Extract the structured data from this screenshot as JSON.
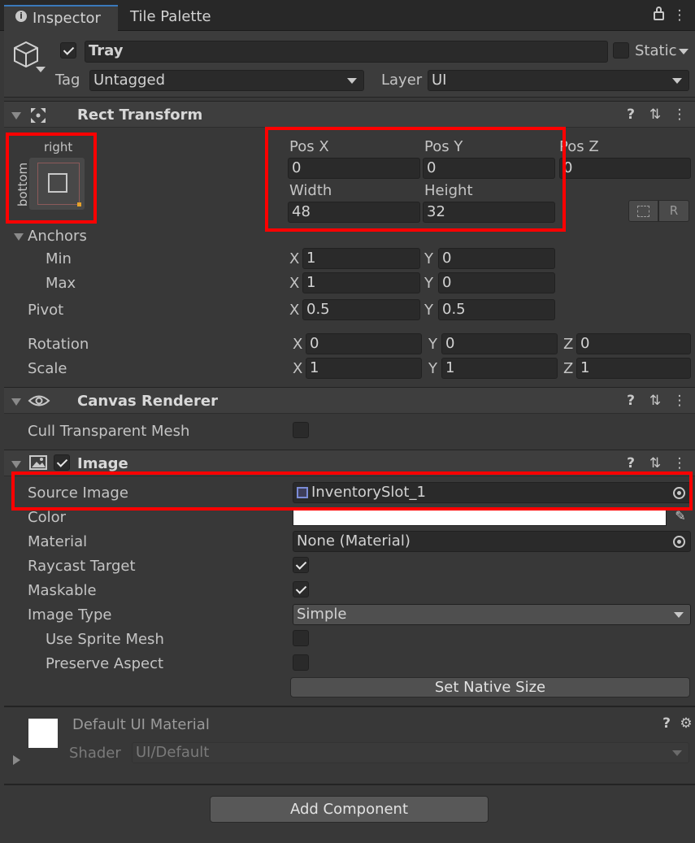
{
  "tabs": {
    "inspector": "Inspector",
    "tile_palette": "Tile Palette"
  },
  "object": {
    "name": "Tray",
    "static_label": "Static",
    "tag_label": "Tag",
    "tag_value": "Untagged",
    "layer_label": "Layer",
    "layer_value": "UI"
  },
  "rect_transform": {
    "title": "Rect Transform",
    "anchor_top_label": "right",
    "anchor_side_label": "bottom",
    "pos_x_label": "Pos X",
    "pos_x": "0",
    "pos_y_label": "Pos Y",
    "pos_y": "0",
    "pos_z_label": "Pos Z",
    "pos_z": "0",
    "width_label": "Width",
    "width": "48",
    "height_label": "Height",
    "height": "32",
    "blueprint_btn": "R",
    "anchors_label": "Anchors",
    "min_label": "Min",
    "min_x": "1",
    "min_y": "0",
    "max_label": "Max",
    "max_x": "1",
    "max_y": "0",
    "pivot_label": "Pivot",
    "pivot_x": "0.5",
    "pivot_y": "0.5",
    "rotation_label": "Rotation",
    "rot_x": "0",
    "rot_y": "0",
    "rot_z": "0",
    "scale_label": "Scale",
    "scale_x": "1",
    "scale_y": "1",
    "scale_z": "1",
    "x": "X",
    "y": "Y",
    "z": "Z"
  },
  "canvas_renderer": {
    "title": "Canvas Renderer",
    "cull_label": "Cull Transparent Mesh"
  },
  "image": {
    "title": "Image",
    "source_label": "Source Image",
    "source_value": "InventorySlot_1",
    "color_label": "Color",
    "material_label": "Material",
    "material_value": "None (Material)",
    "raycast_label": "Raycast Target",
    "maskable_label": "Maskable",
    "type_label": "Image Type",
    "type_value": "Simple",
    "sprite_mesh_label": "Use Sprite Mesh",
    "preserve_label": "Preserve Aspect",
    "native_size_btn": "Set Native Size"
  },
  "material": {
    "name": "Default UI Material",
    "shader_label": "Shader",
    "shader_value": "UI/Default"
  },
  "add_component": "Add Component",
  "colors": {
    "highlight": "#ff0000",
    "tab_accent": "#3a79bb",
    "bg": "#383838"
  }
}
